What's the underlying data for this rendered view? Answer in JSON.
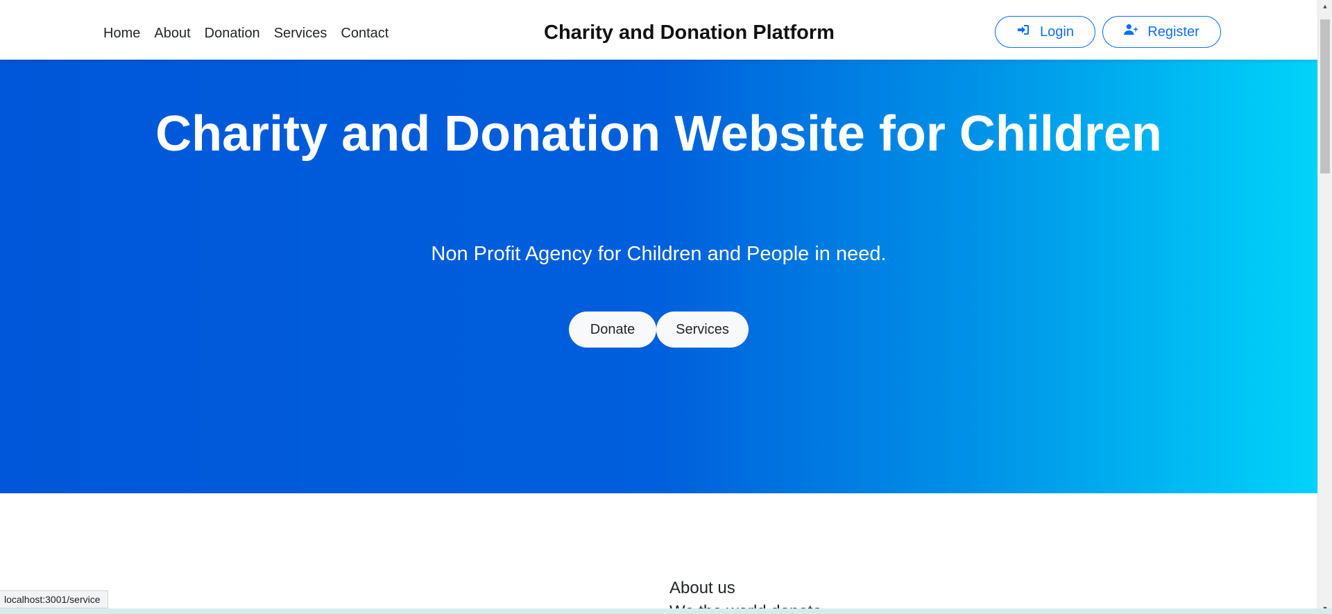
{
  "nav": {
    "links": [
      "Home",
      "About",
      "Donation",
      "Services",
      "Contact"
    ],
    "brand": "Charity and Donation Platform",
    "login_label": "Login",
    "register_label": "Register",
    "login_icon": "sign-in-icon",
    "register_icon": "user-plus-icon"
  },
  "hero": {
    "title": "Charity and Donation Website for Children",
    "subtitle": "Non Profit Agency for Children and People in need.",
    "donate_label": "Donate",
    "services_label": "Services",
    "gradient_start": "#0057d9",
    "gradient_end": "#00d4fa"
  },
  "about": {
    "heading": "About us",
    "next_line": "We the world donate"
  },
  "status_bar": {
    "url": "localhost:3001/service"
  },
  "colors": {
    "accent": "#0d6efd",
    "hero_text": "#ffffff"
  }
}
